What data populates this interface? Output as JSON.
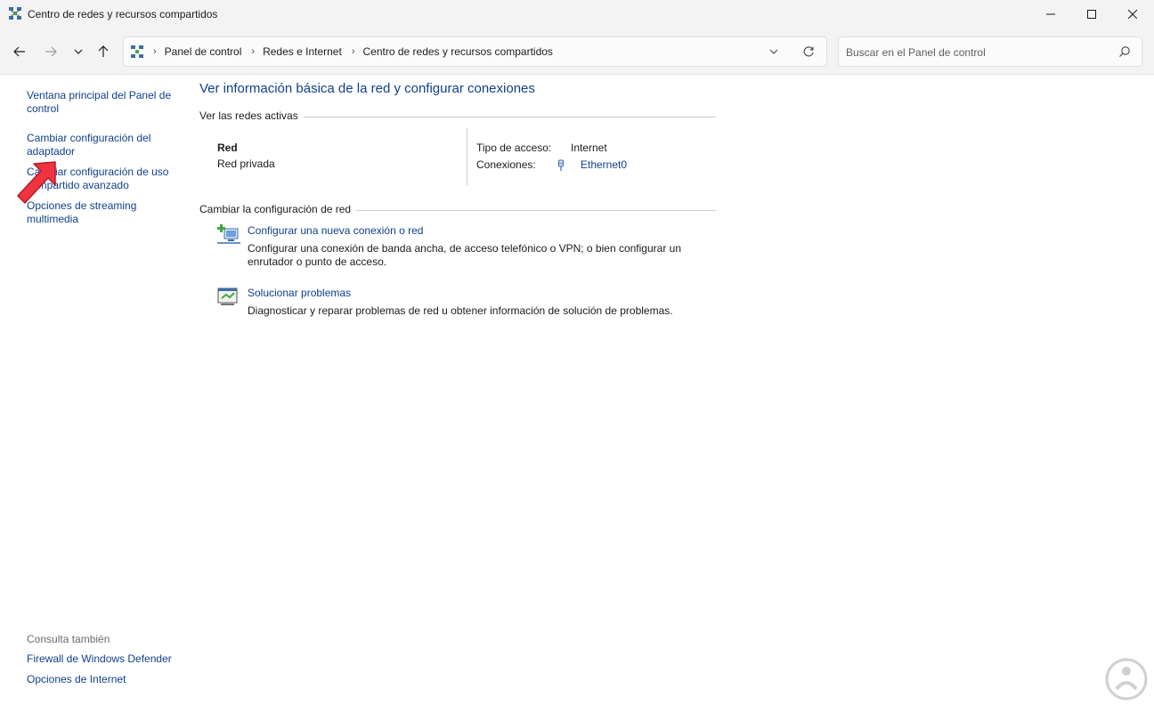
{
  "window": {
    "title": "Centro de redes y recursos compartidos"
  },
  "address": {
    "crumbs": [
      "Panel de control",
      "Redes e Internet",
      "Centro de redes y recursos compartidos"
    ]
  },
  "search": {
    "placeholder": "Buscar en el Panel de control"
  },
  "sidebar": {
    "links": [
      "Ventana principal del Panel de control",
      "Cambiar configuración del adaptador",
      "Cambiar configuración de uso compartido avanzado",
      "Opciones de streaming multimedia"
    ],
    "see_also_label": "Consulta también",
    "see_also": [
      "Firewall de Windows Defender",
      "Opciones de Internet"
    ]
  },
  "main": {
    "title": "Ver información básica de la red y configurar conexiones",
    "active_networks_label": "Ver las redes activas",
    "network": {
      "name": "Red",
      "profile": "Red privada",
      "access_type_label": "Tipo de acceso:",
      "access_type": "Internet",
      "connections_label": "Conexiones:",
      "connection": "Ethernet0"
    },
    "change_label": "Cambiar la configuración de red",
    "tasks": [
      {
        "link": "Configurar una nueva conexión o red",
        "desc": "Configurar una conexión de banda ancha, de acceso telefónico o VPN; o bien configurar un enrutador o punto de acceso.",
        "icon": "new-connection-icon"
      },
      {
        "link": "Solucionar problemas",
        "desc": "Diagnosticar y reparar problemas de red u obtener información de solución de problemas.",
        "icon": "troubleshoot-icon"
      }
    ]
  },
  "colors": {
    "link": "#0f3f8c",
    "chrome": "#f3f3f3",
    "arrow": "#ef3340"
  }
}
